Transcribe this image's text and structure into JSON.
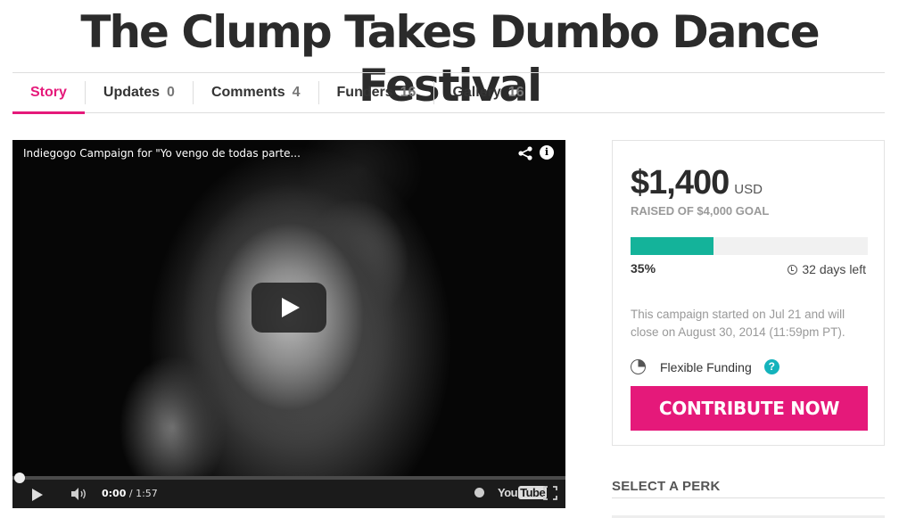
{
  "page_title": "The Clump Takes Dumbo Dance Festival",
  "tabs": [
    {
      "label": "Story",
      "count": ""
    },
    {
      "label": "Updates",
      "count": "0"
    },
    {
      "label": "Comments",
      "count": "4"
    },
    {
      "label": "Funders",
      "count": "16"
    },
    {
      "label": "Gallery",
      "count": "16"
    }
  ],
  "video": {
    "title": "Indiegogo Campaign for \"Yo vengo de todas parte...",
    "time_current": "0:00",
    "time_total": "/ 1:57",
    "brand": "You",
    "brand_tube": "Tube"
  },
  "campaign": {
    "amount": "$1,400",
    "currency": "USD",
    "goal_text": "RAISED OF $4,000 GOAL",
    "percent_label": "35%",
    "progress_fraction": 0.35,
    "days_left": "32 days left",
    "note": "This campaign started on Jul 21 and will close on August 30, 2014 (11:59pm PT).",
    "funding_type": "Flexible Funding",
    "help": "?",
    "contribute_label": "CONTRIBUTE NOW"
  },
  "perks": {
    "heading": "SELECT A PERK"
  },
  "colors": {
    "accent": "#e5197a",
    "progress": "#14b39a",
    "help": "#14b3bc"
  }
}
